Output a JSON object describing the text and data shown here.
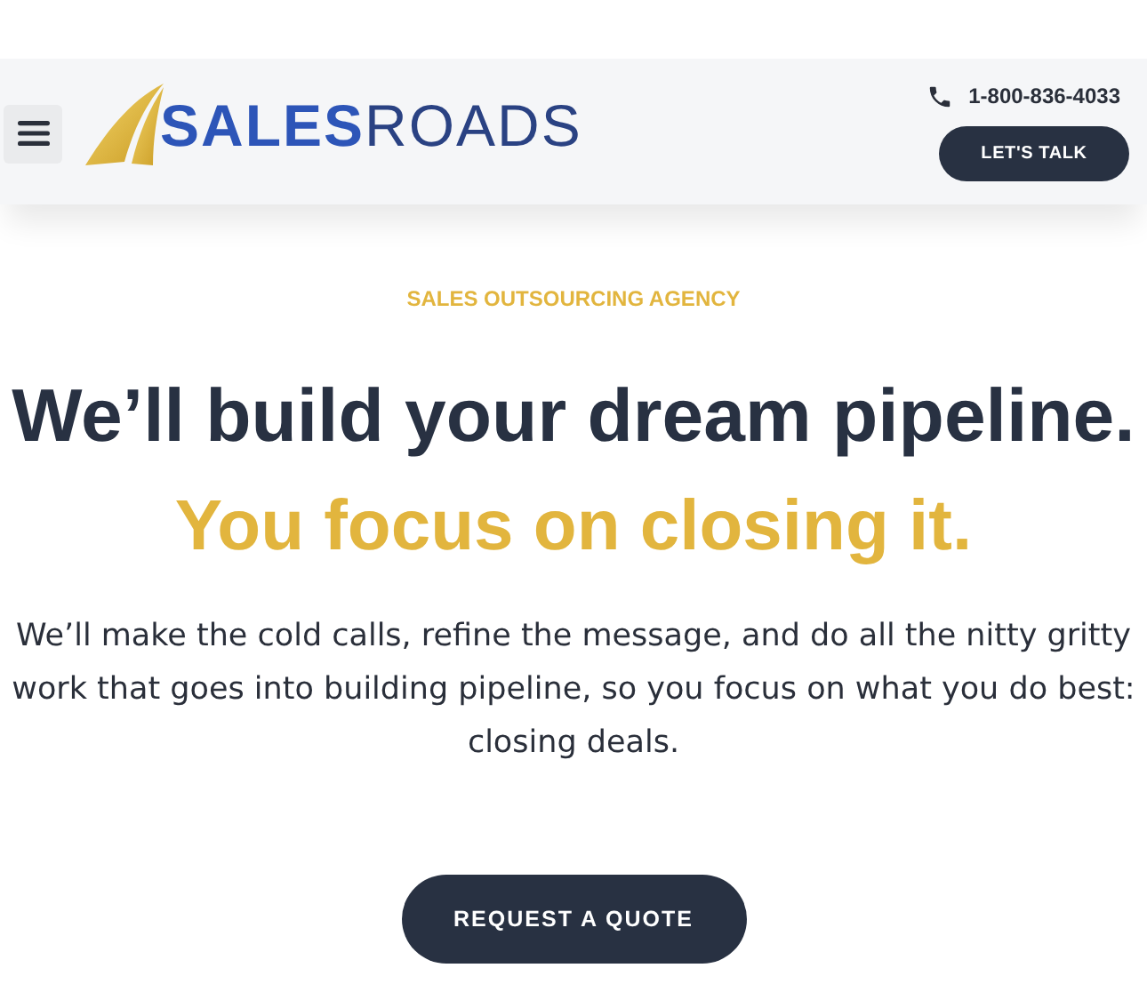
{
  "header": {
    "logo": {
      "bold_part": "SALES",
      "light_part": "ROADS"
    },
    "phone": "1-800-836-4033",
    "cta": "LET'S TALK"
  },
  "hero": {
    "eyebrow": "SALES OUTSOURCING AGENCY",
    "headline": "We’ll build your dream pipeline.",
    "subheadline": "You focus on closing it.",
    "body": "We’ll make the cold calls, refine the message, and do all the nitty gritty work that goes into building pipeline, so you focus on what you do best: closing deals.",
    "button": "REQUEST A QUOTE"
  }
}
